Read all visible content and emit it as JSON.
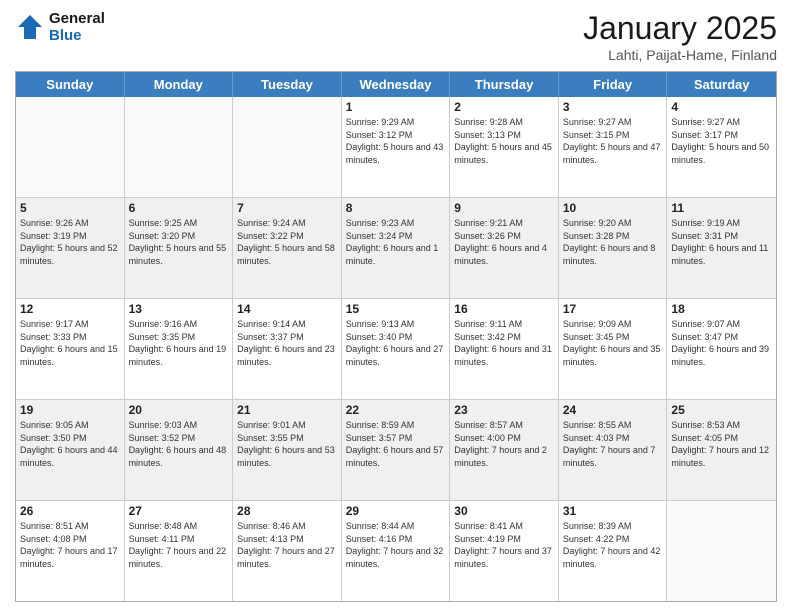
{
  "header": {
    "logo_line1": "General",
    "logo_line2": "Blue",
    "month_title": "January 2025",
    "location": "Lahti, Paijat-Hame, Finland"
  },
  "days_of_week": [
    "Sunday",
    "Monday",
    "Tuesday",
    "Wednesday",
    "Thursday",
    "Friday",
    "Saturday"
  ],
  "weeks": [
    [
      {
        "day": "",
        "empty": true
      },
      {
        "day": "",
        "empty": true
      },
      {
        "day": "",
        "empty": true
      },
      {
        "day": "1",
        "sunrise": "9:29 AM",
        "sunset": "3:12 PM",
        "daylight": "5 hours and 43 minutes."
      },
      {
        "day": "2",
        "sunrise": "9:28 AM",
        "sunset": "3:13 PM",
        "daylight": "5 hours and 45 minutes."
      },
      {
        "day": "3",
        "sunrise": "9:27 AM",
        "sunset": "3:15 PM",
        "daylight": "5 hours and 47 minutes."
      },
      {
        "day": "4",
        "sunrise": "9:27 AM",
        "sunset": "3:17 PM",
        "daylight": "5 hours and 50 minutes."
      }
    ],
    [
      {
        "day": "5",
        "sunrise": "9:26 AM",
        "sunset": "3:19 PM",
        "daylight": "5 hours and 52 minutes."
      },
      {
        "day": "6",
        "sunrise": "9:25 AM",
        "sunset": "3:20 PM",
        "daylight": "5 hours and 55 minutes."
      },
      {
        "day": "7",
        "sunrise": "9:24 AM",
        "sunset": "3:22 PM",
        "daylight": "5 hours and 58 minutes."
      },
      {
        "day": "8",
        "sunrise": "9:23 AM",
        "sunset": "3:24 PM",
        "daylight": "6 hours and 1 minute."
      },
      {
        "day": "9",
        "sunrise": "9:21 AM",
        "sunset": "3:26 PM",
        "daylight": "6 hours and 4 minutes."
      },
      {
        "day": "10",
        "sunrise": "9:20 AM",
        "sunset": "3:28 PM",
        "daylight": "6 hours and 8 minutes."
      },
      {
        "day": "11",
        "sunrise": "9:19 AM",
        "sunset": "3:31 PM",
        "daylight": "6 hours and 11 minutes."
      }
    ],
    [
      {
        "day": "12",
        "sunrise": "9:17 AM",
        "sunset": "3:33 PM",
        "daylight": "6 hours and 15 minutes."
      },
      {
        "day": "13",
        "sunrise": "9:16 AM",
        "sunset": "3:35 PM",
        "daylight": "6 hours and 19 minutes."
      },
      {
        "day": "14",
        "sunrise": "9:14 AM",
        "sunset": "3:37 PM",
        "daylight": "6 hours and 23 minutes."
      },
      {
        "day": "15",
        "sunrise": "9:13 AM",
        "sunset": "3:40 PM",
        "daylight": "6 hours and 27 minutes."
      },
      {
        "day": "16",
        "sunrise": "9:11 AM",
        "sunset": "3:42 PM",
        "daylight": "6 hours and 31 minutes."
      },
      {
        "day": "17",
        "sunrise": "9:09 AM",
        "sunset": "3:45 PM",
        "daylight": "6 hours and 35 minutes."
      },
      {
        "day": "18",
        "sunrise": "9:07 AM",
        "sunset": "3:47 PM",
        "daylight": "6 hours and 39 minutes."
      }
    ],
    [
      {
        "day": "19",
        "sunrise": "9:05 AM",
        "sunset": "3:50 PM",
        "daylight": "6 hours and 44 minutes."
      },
      {
        "day": "20",
        "sunrise": "9:03 AM",
        "sunset": "3:52 PM",
        "daylight": "6 hours and 48 minutes."
      },
      {
        "day": "21",
        "sunrise": "9:01 AM",
        "sunset": "3:55 PM",
        "daylight": "6 hours and 53 minutes."
      },
      {
        "day": "22",
        "sunrise": "8:59 AM",
        "sunset": "3:57 PM",
        "daylight": "6 hours and 57 minutes."
      },
      {
        "day": "23",
        "sunrise": "8:57 AM",
        "sunset": "4:00 PM",
        "daylight": "7 hours and 2 minutes."
      },
      {
        "day": "24",
        "sunrise": "8:55 AM",
        "sunset": "4:03 PM",
        "daylight": "7 hours and 7 minutes."
      },
      {
        "day": "25",
        "sunrise": "8:53 AM",
        "sunset": "4:05 PM",
        "daylight": "7 hours and 12 minutes."
      }
    ],
    [
      {
        "day": "26",
        "sunrise": "8:51 AM",
        "sunset": "4:08 PM",
        "daylight": "7 hours and 17 minutes."
      },
      {
        "day": "27",
        "sunrise": "8:48 AM",
        "sunset": "4:11 PM",
        "daylight": "7 hours and 22 minutes."
      },
      {
        "day": "28",
        "sunrise": "8:46 AM",
        "sunset": "4:13 PM",
        "daylight": "7 hours and 27 minutes."
      },
      {
        "day": "29",
        "sunrise": "8:44 AM",
        "sunset": "4:16 PM",
        "daylight": "7 hours and 32 minutes."
      },
      {
        "day": "30",
        "sunrise": "8:41 AM",
        "sunset": "4:19 PM",
        "daylight": "7 hours and 37 minutes."
      },
      {
        "day": "31",
        "sunrise": "8:39 AM",
        "sunset": "4:22 PM",
        "daylight": "7 hours and 42 minutes."
      },
      {
        "day": "",
        "empty": true
      }
    ]
  ]
}
